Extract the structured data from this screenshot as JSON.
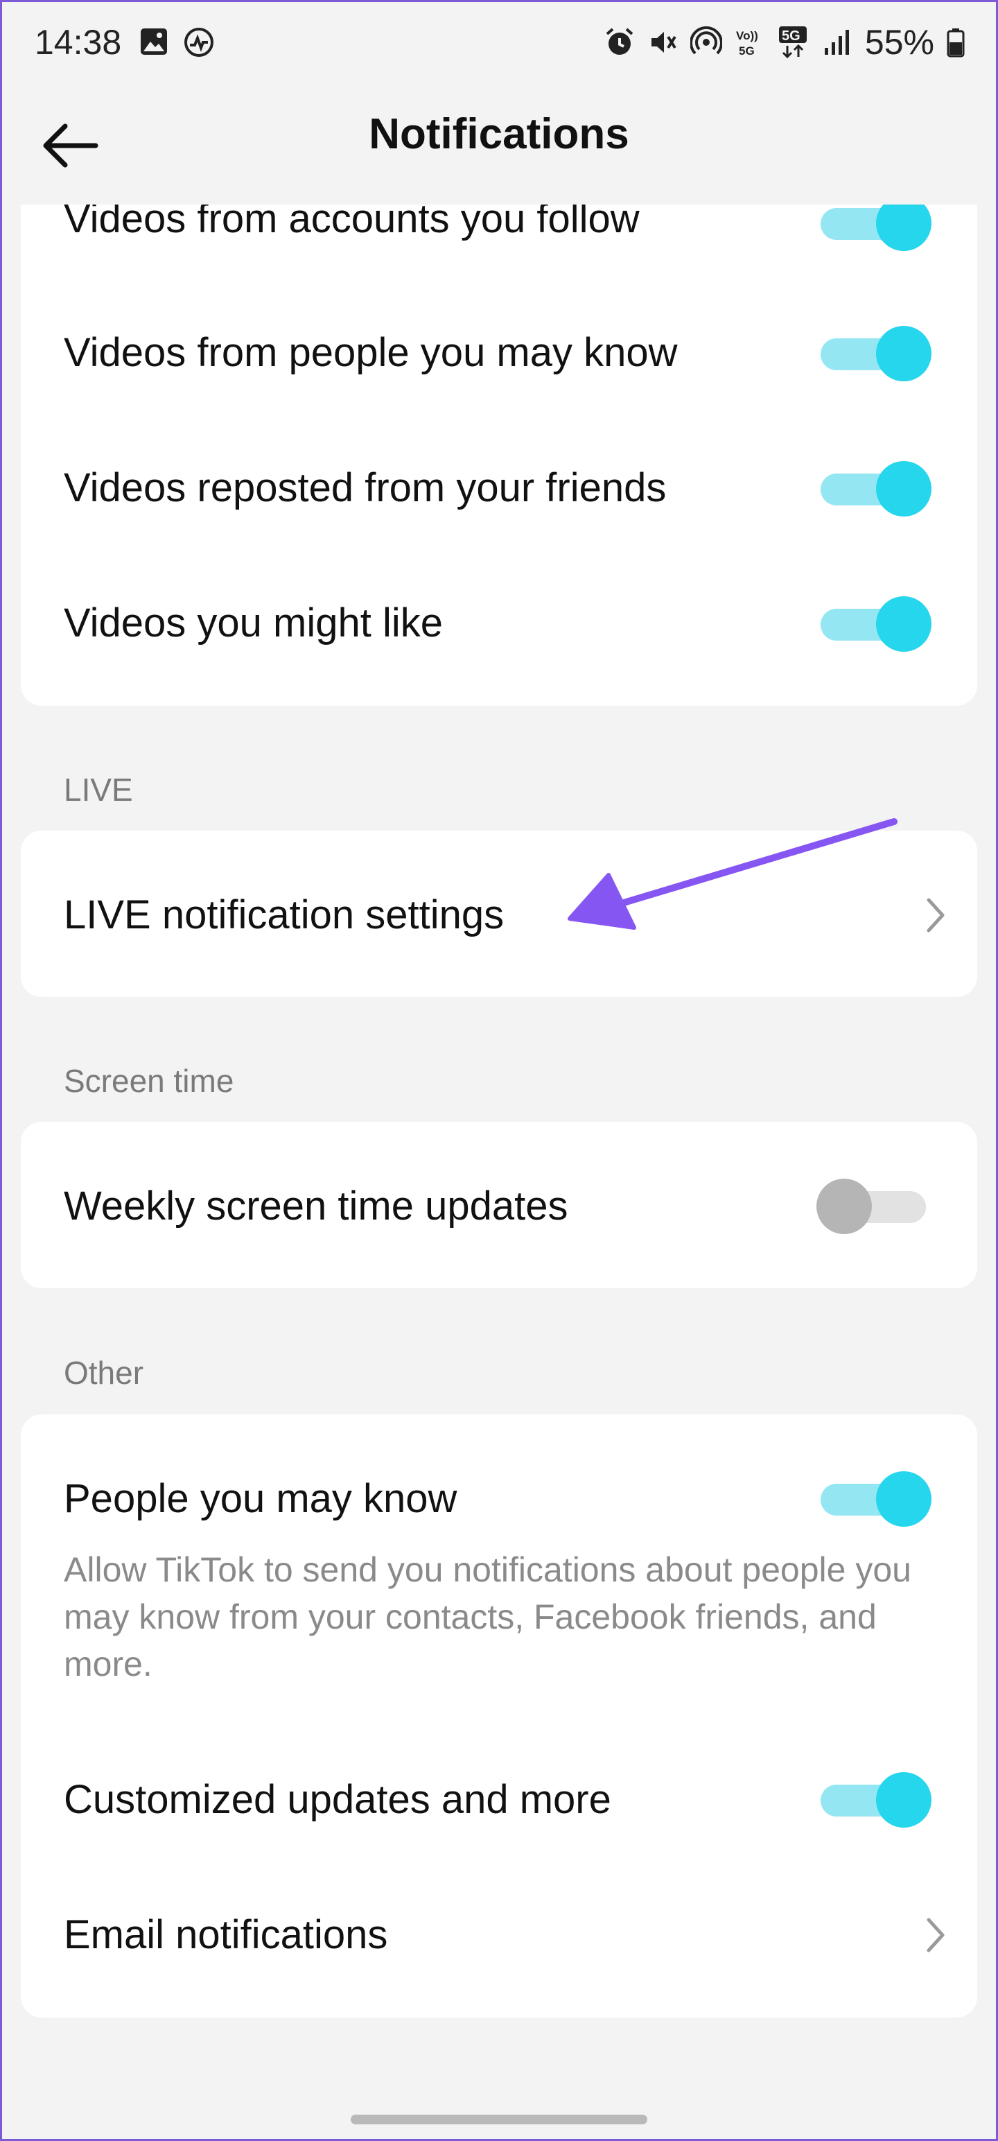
{
  "status_bar": {
    "time": "14:38",
    "battery": "55%"
  },
  "header": {
    "title": "Notifications"
  },
  "video_section": {
    "items": [
      {
        "label": "Videos from accounts you follow",
        "on": true
      },
      {
        "label": "Videos from people you may know",
        "on": true
      },
      {
        "label": "Videos reposted from your friends",
        "on": true
      },
      {
        "label": "Videos you might like",
        "on": true
      }
    ]
  },
  "live_section": {
    "header": "LIVE",
    "item": {
      "label": "LIVE notification settings"
    }
  },
  "screen_time_section": {
    "header": "Screen time",
    "item": {
      "label": "Weekly screen time updates",
      "on": false
    }
  },
  "other_section": {
    "header": "Other",
    "people_you_may_know": {
      "label": "People you may know",
      "description": "Allow TikTok to send you notifications about people you may know from your contacts, Facebook friends, and more.",
      "on": true
    },
    "customized_updates": {
      "label": "Customized updates and more",
      "on": true
    },
    "email_notifications": {
      "label": "Email notifications"
    }
  },
  "colors": {
    "toggle_on_knob": "#25d6ec",
    "toggle_on_track": "#94e6f2",
    "toggle_off_knob": "#b5b5b5",
    "annotation_arrow": "#8656f3"
  }
}
